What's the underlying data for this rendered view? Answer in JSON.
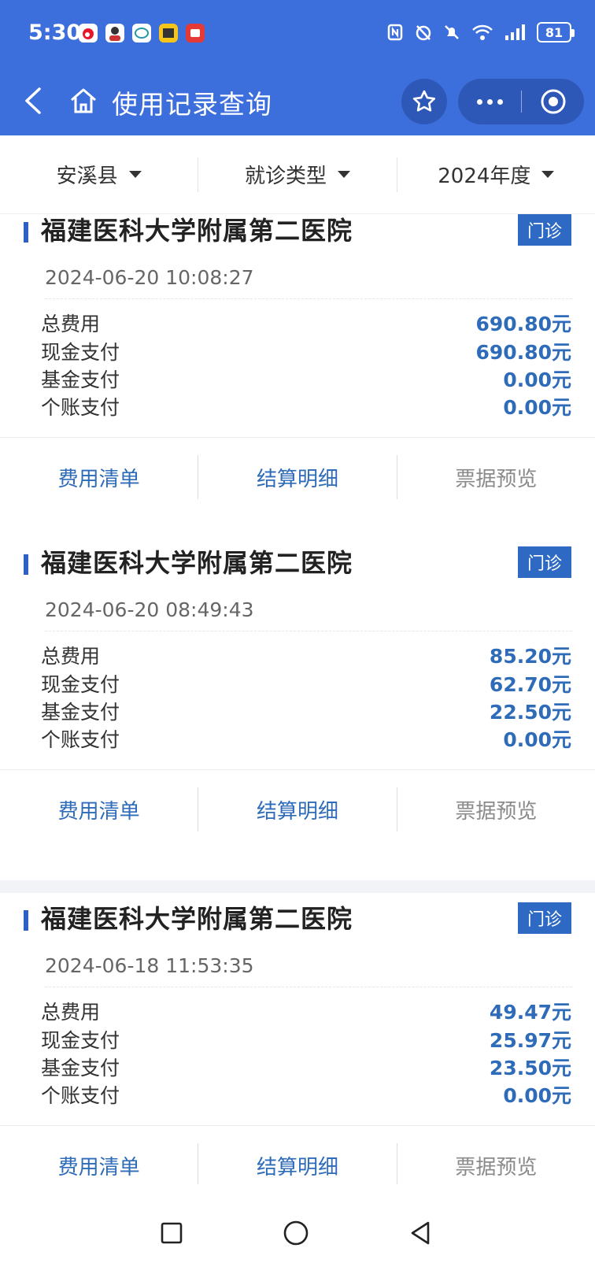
{
  "status": {
    "time": "5:30",
    "battery": "81"
  },
  "nav": {
    "title": "使用记录查询"
  },
  "filters": [
    {
      "label": "安溪县"
    },
    {
      "label": "就诊类型"
    },
    {
      "label": "2024年度"
    }
  ],
  "labels": {
    "total": "总费用",
    "cash": "现金支付",
    "fund": "基金支付",
    "account": "个账支付"
  },
  "actions": {
    "fee_list": "费用清单",
    "settlement": "结算明细",
    "receipt": "票据预览"
  },
  "records": [
    {
      "hospital": "福建医科大学附属第二医院",
      "type": "门诊",
      "datetime": "2024-06-20 10:08:27",
      "total": "690.80元",
      "cash": "690.80元",
      "fund": "0.00元",
      "account": "0.00元"
    },
    {
      "hospital": "福建医科大学附属第二医院",
      "type": "门诊",
      "datetime": "2024-06-20 08:49:43",
      "total": "85.20元",
      "cash": "62.70元",
      "fund": "22.50元",
      "account": "0.00元"
    },
    {
      "hospital": "福建医科大学附属第二医院",
      "type": "门诊",
      "datetime": "2024-06-18 11:53:35",
      "total": "49.47元",
      "cash": "25.97元",
      "fund": "23.50元",
      "account": "0.00元"
    }
  ],
  "colors": {
    "primary": "#3d6fdc",
    "value": "#2e6bb8",
    "badge": "#2e69c4"
  }
}
